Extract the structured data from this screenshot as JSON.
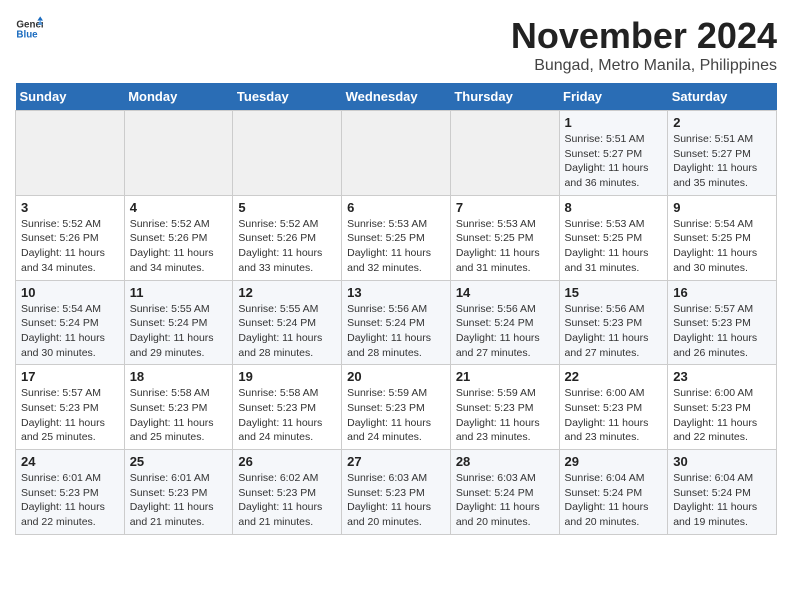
{
  "header": {
    "logo_general": "General",
    "logo_blue": "Blue",
    "title": "November 2024",
    "subtitle": "Bungad, Metro Manila, Philippines"
  },
  "calendar": {
    "days_of_week": [
      "Sunday",
      "Monday",
      "Tuesday",
      "Wednesday",
      "Thursday",
      "Friday",
      "Saturday"
    ],
    "weeks": [
      [
        {
          "day": "",
          "detail": ""
        },
        {
          "day": "",
          "detail": ""
        },
        {
          "day": "",
          "detail": ""
        },
        {
          "day": "",
          "detail": ""
        },
        {
          "day": "",
          "detail": ""
        },
        {
          "day": "1",
          "detail": "Sunrise: 5:51 AM\nSunset: 5:27 PM\nDaylight: 11 hours\nand 36 minutes."
        },
        {
          "day": "2",
          "detail": "Sunrise: 5:51 AM\nSunset: 5:27 PM\nDaylight: 11 hours\nand 35 minutes."
        }
      ],
      [
        {
          "day": "3",
          "detail": "Sunrise: 5:52 AM\nSunset: 5:26 PM\nDaylight: 11 hours\nand 34 minutes."
        },
        {
          "day": "4",
          "detail": "Sunrise: 5:52 AM\nSunset: 5:26 PM\nDaylight: 11 hours\nand 34 minutes."
        },
        {
          "day": "5",
          "detail": "Sunrise: 5:52 AM\nSunset: 5:26 PM\nDaylight: 11 hours\nand 33 minutes."
        },
        {
          "day": "6",
          "detail": "Sunrise: 5:53 AM\nSunset: 5:25 PM\nDaylight: 11 hours\nand 32 minutes."
        },
        {
          "day": "7",
          "detail": "Sunrise: 5:53 AM\nSunset: 5:25 PM\nDaylight: 11 hours\nand 31 minutes."
        },
        {
          "day": "8",
          "detail": "Sunrise: 5:53 AM\nSunset: 5:25 PM\nDaylight: 11 hours\nand 31 minutes."
        },
        {
          "day": "9",
          "detail": "Sunrise: 5:54 AM\nSunset: 5:25 PM\nDaylight: 11 hours\nand 30 minutes."
        }
      ],
      [
        {
          "day": "10",
          "detail": "Sunrise: 5:54 AM\nSunset: 5:24 PM\nDaylight: 11 hours\nand 30 minutes."
        },
        {
          "day": "11",
          "detail": "Sunrise: 5:55 AM\nSunset: 5:24 PM\nDaylight: 11 hours\nand 29 minutes."
        },
        {
          "day": "12",
          "detail": "Sunrise: 5:55 AM\nSunset: 5:24 PM\nDaylight: 11 hours\nand 28 minutes."
        },
        {
          "day": "13",
          "detail": "Sunrise: 5:56 AM\nSunset: 5:24 PM\nDaylight: 11 hours\nand 28 minutes."
        },
        {
          "day": "14",
          "detail": "Sunrise: 5:56 AM\nSunset: 5:24 PM\nDaylight: 11 hours\nand 27 minutes."
        },
        {
          "day": "15",
          "detail": "Sunrise: 5:56 AM\nSunset: 5:23 PM\nDaylight: 11 hours\nand 27 minutes."
        },
        {
          "day": "16",
          "detail": "Sunrise: 5:57 AM\nSunset: 5:23 PM\nDaylight: 11 hours\nand 26 minutes."
        }
      ],
      [
        {
          "day": "17",
          "detail": "Sunrise: 5:57 AM\nSunset: 5:23 PM\nDaylight: 11 hours\nand 25 minutes."
        },
        {
          "day": "18",
          "detail": "Sunrise: 5:58 AM\nSunset: 5:23 PM\nDaylight: 11 hours\nand 25 minutes."
        },
        {
          "day": "19",
          "detail": "Sunrise: 5:58 AM\nSunset: 5:23 PM\nDaylight: 11 hours\nand 24 minutes."
        },
        {
          "day": "20",
          "detail": "Sunrise: 5:59 AM\nSunset: 5:23 PM\nDaylight: 11 hours\nand 24 minutes."
        },
        {
          "day": "21",
          "detail": "Sunrise: 5:59 AM\nSunset: 5:23 PM\nDaylight: 11 hours\nand 23 minutes."
        },
        {
          "day": "22",
          "detail": "Sunrise: 6:00 AM\nSunset: 5:23 PM\nDaylight: 11 hours\nand 23 minutes."
        },
        {
          "day": "23",
          "detail": "Sunrise: 6:00 AM\nSunset: 5:23 PM\nDaylight: 11 hours\nand 22 minutes."
        }
      ],
      [
        {
          "day": "24",
          "detail": "Sunrise: 6:01 AM\nSunset: 5:23 PM\nDaylight: 11 hours\nand 22 minutes."
        },
        {
          "day": "25",
          "detail": "Sunrise: 6:01 AM\nSunset: 5:23 PM\nDaylight: 11 hours\nand 21 minutes."
        },
        {
          "day": "26",
          "detail": "Sunrise: 6:02 AM\nSunset: 5:23 PM\nDaylight: 11 hours\nand 21 minutes."
        },
        {
          "day": "27",
          "detail": "Sunrise: 6:03 AM\nSunset: 5:23 PM\nDaylight: 11 hours\nand 20 minutes."
        },
        {
          "day": "28",
          "detail": "Sunrise: 6:03 AM\nSunset: 5:24 PM\nDaylight: 11 hours\nand 20 minutes."
        },
        {
          "day": "29",
          "detail": "Sunrise: 6:04 AM\nSunset: 5:24 PM\nDaylight: 11 hours\nand 20 minutes."
        },
        {
          "day": "30",
          "detail": "Sunrise: 6:04 AM\nSunset: 5:24 PM\nDaylight: 11 hours\nand 19 minutes."
        }
      ]
    ]
  }
}
